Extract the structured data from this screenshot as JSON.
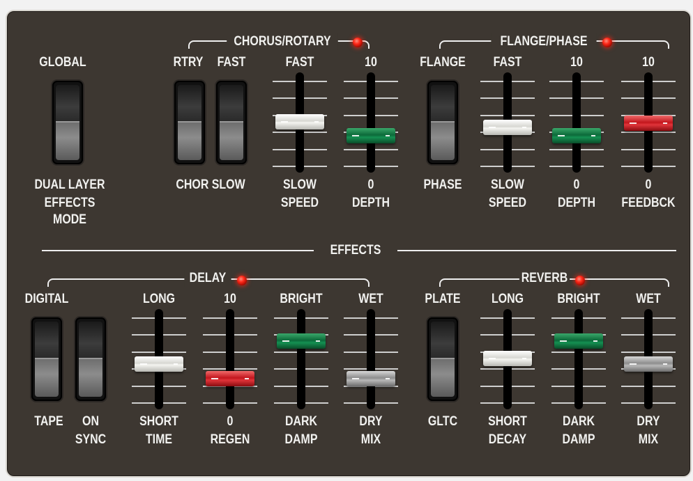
{
  "sections": {
    "global": {
      "top_label": "GLOBAL",
      "bottom_lines": [
        "DUAL LAYER",
        "EFFECTS",
        "MODE"
      ]
    },
    "chorus_rotary": {
      "title": "CHORUS/ROTARY",
      "switch_top": [
        "RTRY",
        "FAST"
      ],
      "switch_bottom": "CHOR SLOW",
      "sliders": [
        {
          "top": "FAST",
          "bottom": [
            "SLOW",
            "SPEED"
          ],
          "color": "white",
          "level": 0.52
        },
        {
          "top": "10",
          "bottom": [
            "0",
            "DEPTH"
          ],
          "color": "green",
          "level": 0.35
        }
      ]
    },
    "flange_phase": {
      "title": "FLANGE/PHASE",
      "switch_top": "FLANGE",
      "switch_bottom": "PHASE",
      "sliders": [
        {
          "top": "FAST",
          "bottom": [
            "SLOW",
            "SPEED"
          ],
          "color": "white",
          "level": 0.45
        },
        {
          "top": "10",
          "bottom": [
            "0",
            "DEPTH"
          ],
          "color": "green",
          "level": 0.35
        },
        {
          "top": "10",
          "bottom": [
            "0",
            "FEEDBCK"
          ],
          "color": "red",
          "level": 0.5
        }
      ]
    },
    "effects_heading": "EFFECTS",
    "delay": {
      "title": "DELAY",
      "switch_top": "DIGITAL",
      "switch_bottom": [
        "TAPE",
        "ON",
        "SYNC"
      ],
      "sliders": [
        {
          "top": "LONG",
          "bottom": [
            "SHORT",
            "TIME"
          ],
          "color": "white",
          "level": 0.45
        },
        {
          "top": "10",
          "bottom": [
            "0",
            "REGEN"
          ],
          "color": "red",
          "level": 0.28
        },
        {
          "top": "BRIGHT",
          "bottom": [
            "DARK",
            "DAMP"
          ],
          "color": "green",
          "level": 0.72
        },
        {
          "top": "WET",
          "bottom": [
            "DRY",
            "MIX"
          ],
          "color": "grey",
          "level": 0.28
        }
      ]
    },
    "reverb": {
      "title": "REVERB",
      "switch_top": "PLATE",
      "switch_bottom": "GLTC",
      "sliders": [
        {
          "top": "LONG",
          "bottom": [
            "SHORT",
            "DECAY"
          ],
          "color": "white",
          "level": 0.52
        },
        {
          "top": "BRIGHT",
          "bottom": [
            "DARK",
            "DAMP"
          ],
          "color": "green",
          "level": 0.72
        },
        {
          "top": "WET",
          "bottom": [
            "DRY",
            "MIX"
          ],
          "color": "grey",
          "level": 0.45
        }
      ]
    }
  },
  "colors": {
    "panel": "#3d3731",
    "text": "#f1f1ef",
    "led": "#ff2a1a"
  }
}
